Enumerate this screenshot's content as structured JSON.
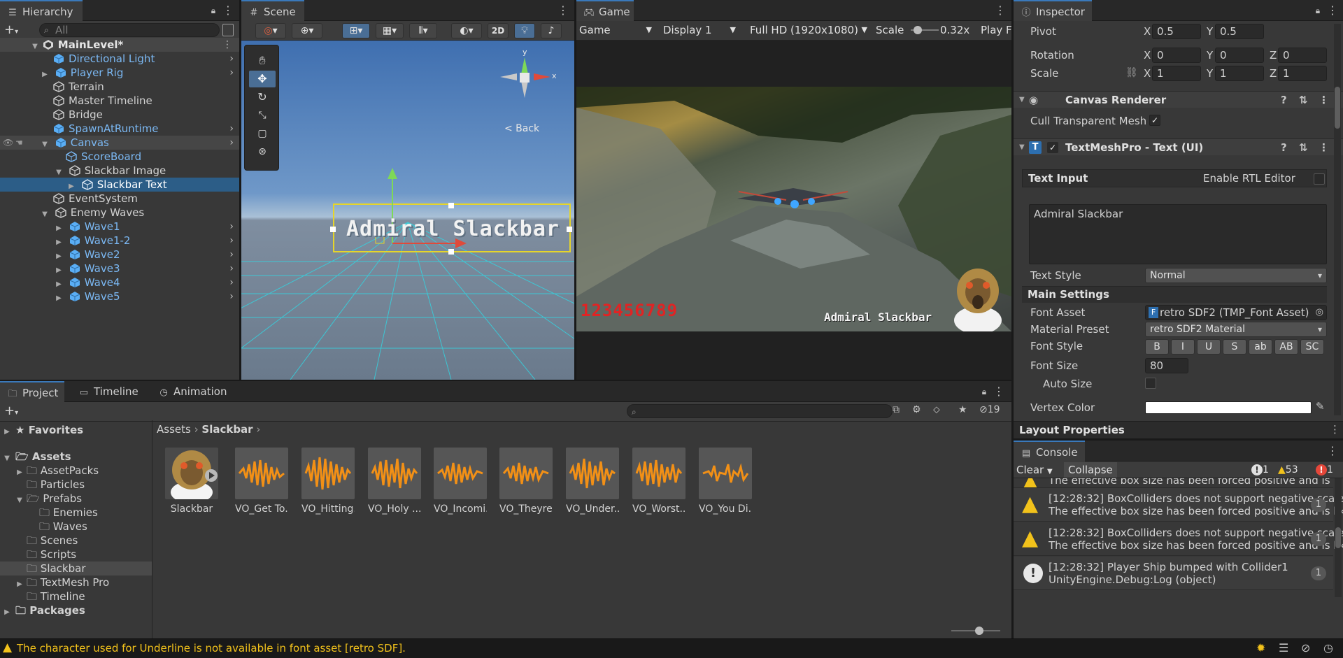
{
  "hierarchy": {
    "tab_label": "Hierarchy",
    "search_placeholder": "All",
    "items": [
      {
        "label": "MainLevel*"
      },
      {
        "label": "Directional Light"
      },
      {
        "label": "Player Rig"
      },
      {
        "label": "Terrain"
      },
      {
        "label": "Master Timeline"
      },
      {
        "label": "Bridge"
      },
      {
        "label": "SpawnAtRuntime"
      },
      {
        "label": "Canvas"
      },
      {
        "label": "ScoreBoard"
      },
      {
        "label": "Slackbar Image"
      },
      {
        "label": "Slackbar Text"
      },
      {
        "label": "EventSystem"
      },
      {
        "label": "Enemy Waves"
      },
      {
        "label": "Wave1"
      },
      {
        "label": "Wave1-2"
      },
      {
        "label": "Wave2"
      },
      {
        "label": "Wave3"
      },
      {
        "label": "Wave4"
      },
      {
        "label": "Wave5"
      }
    ]
  },
  "scene": {
    "tab_label": "Scene",
    "mode_2d": "2D",
    "back_label": "< Back",
    "gizmo_y": "y",
    "gizmo_x": "x",
    "ui_text": "Admiral Slackbar"
  },
  "game": {
    "tab_label": "Game",
    "view_dropdown": "Game",
    "display_dropdown": "Display 1",
    "resolution_dropdown": "Full HD (1920x1080)",
    "scale_label": "Scale",
    "scale_value": "0.32x",
    "play_label": "Play F",
    "score_text": "123456789",
    "ui_text": "Admiral Slackbar"
  },
  "inspector": {
    "tab_label": "Inspector",
    "pivot_label": "Pivot",
    "pivot": {
      "x": "0.5",
      "y": "0.5"
    },
    "rotation_label": "Rotation",
    "rotation": {
      "x": "0",
      "y": "0",
      "z": "0"
    },
    "scale_label": "Scale",
    "scale": {
      "x": "1",
      "y": "1",
      "z": "1"
    },
    "axis_x": "X",
    "axis_y": "Y",
    "axis_z": "Z",
    "canvas_renderer": "Canvas Renderer",
    "cull_label": "Cull Transparent Mesh",
    "tmp_component": "TextMeshPro - Text (UI)",
    "text_input_label": "Text Input",
    "rtl_label": "Enable RTL Editor",
    "text_value": "Admiral Slackbar",
    "text_style_label": "Text Style",
    "text_style_value": "Normal",
    "main_settings": "Main Settings",
    "font_asset_label": "Font Asset",
    "font_asset_value": "retro SDF2 (TMP_Font Asset)",
    "material_preset_label": "Material Preset",
    "material_preset_value": "retro SDF2 Material",
    "font_style_label": "Font Style",
    "font_style_buttons": [
      "B",
      "I",
      "U",
      "S",
      "ab",
      "AB",
      "SC"
    ],
    "font_size_label": "Font Size",
    "font_size_value": "80",
    "auto_size_label": "Auto Size",
    "vertex_color_label": "Vertex Color",
    "layout_properties": "Layout Properties"
  },
  "project": {
    "tabs": [
      "Project",
      "Timeline",
      "Animation"
    ],
    "hidden_count": "19",
    "breadcrumb": [
      "Assets",
      "Slackbar"
    ],
    "tree": [
      {
        "label": "Favorites"
      },
      {
        "label": "Assets"
      },
      {
        "label": "AssetPacks"
      },
      {
        "label": "Particles"
      },
      {
        "label": "Prefabs"
      },
      {
        "label": "Enemies"
      },
      {
        "label": "Waves"
      },
      {
        "label": "Scenes"
      },
      {
        "label": "Scripts"
      },
      {
        "label": "Slackbar"
      },
      {
        "label": "TextMesh Pro"
      },
      {
        "label": "Timeline"
      },
      {
        "label": "Packages"
      }
    ],
    "assets": [
      {
        "name": "Slackbar"
      },
      {
        "name": "VO_Get To..."
      },
      {
        "name": "VO_Hitting..."
      },
      {
        "name": "VO_Holy ..."
      },
      {
        "name": "VO_Incomi..."
      },
      {
        "name": "VO_Theyre..."
      },
      {
        "name": "VO_Under..."
      },
      {
        "name": "VO_Worst..."
      },
      {
        "name": "VO_You Di..."
      }
    ]
  },
  "console": {
    "tab_label": "Console",
    "clear_label": "Clear",
    "collapse_label": "Collapse",
    "info_count": "1",
    "warn_count": "53",
    "error_count": "1",
    "top_partial": "The effective box size has been forced positive and is lik",
    "messages": [
      {
        "line1": "[12:28:32] BoxColliders does not support negative scale",
        "line2": "The effective box size has been forced positive and is lik",
        "count": "1",
        "type": "warning"
      },
      {
        "line1": "[12:28:32] BoxColliders does not support negative scale",
        "line2": "The effective box size has been forced positive and is lik",
        "count": "1",
        "type": "warning"
      },
      {
        "line1": "[12:28:32] Player Ship bumped with Collider1",
        "line2": "UnityEngine.Debug:Log (object)",
        "count": "1",
        "type": "info"
      }
    ]
  },
  "status_bar": {
    "message": "The character used for Underline is not available in font asset [retro SDF]."
  },
  "colors": {
    "selection": "#2c5d87",
    "accent_blue": "#7bb8f3",
    "warning_yellow": "#f2c21b",
    "audio_orange": "#f29016"
  }
}
